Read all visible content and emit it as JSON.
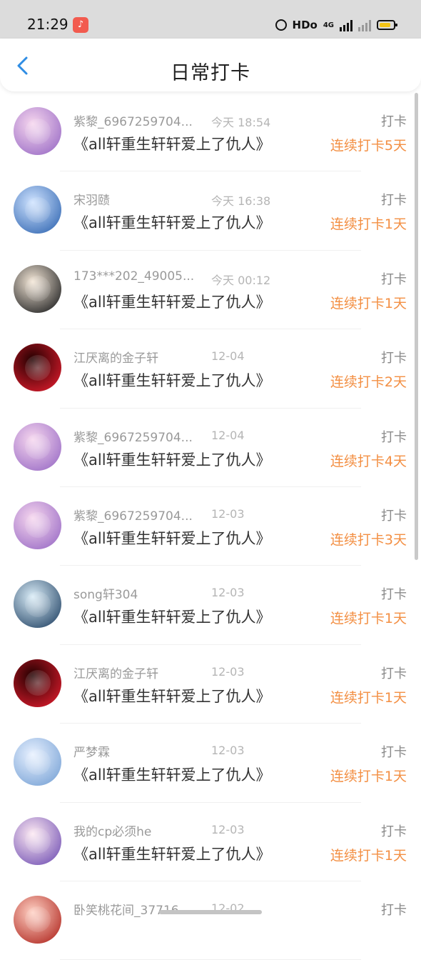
{
  "status_bar": {
    "time": "21:29",
    "app_icon": "music-app-icon",
    "hd": "HDo",
    "network": "4G"
  },
  "header": {
    "title": "日常打卡",
    "back_icon": "chevron-left-icon"
  },
  "entries": [
    {
      "name": "紫黎_6967259704...",
      "time": "今天 18:54",
      "book": "《all轩重生轩轩爱上了仇人》",
      "action": "打卡",
      "streak": "连续打卡5天",
      "avatar_colors": [
        "#f6d6ee",
        "#9f72c8"
      ]
    },
    {
      "name": "宋羽赜",
      "time": "今天 16:38",
      "book": "《all轩重生轩轩爱上了仇人》",
      "action": "打卡",
      "streak": "连续打卡1天",
      "avatar_colors": [
        "#cfe3ff",
        "#3c6fb7"
      ]
    },
    {
      "name": "173***202_49005...",
      "time": "今天 00:12",
      "book": "《all轩重生轩轩爱上了仇人》",
      "action": "打卡",
      "streak": "连续打卡1天",
      "avatar_colors": [
        "#f3e6d6",
        "#2a2a2a"
      ]
    },
    {
      "name": "江厌离的金子轩",
      "time": "12-04",
      "book": "《all轩重生轩轩爱上了仇人》",
      "action": "打卡",
      "streak": "连续打卡2天",
      "avatar_colors": [
        "#220000",
        "#d11a2a"
      ]
    },
    {
      "name": "紫黎_6967259704...",
      "time": "12-04",
      "book": "《all轩重生轩轩爱上了仇人》",
      "action": "打卡",
      "streak": "连续打卡4天",
      "avatar_colors": [
        "#f6d6ee",
        "#9f72c8"
      ]
    },
    {
      "name": "紫黎_6967259704...",
      "time": "12-03",
      "book": "《all轩重生轩轩爱上了仇人》",
      "action": "打卡",
      "streak": "连续打卡3天",
      "avatar_colors": [
        "#f6d6ee",
        "#9f72c8"
      ]
    },
    {
      "name": "song轩304",
      "time": "12-03",
      "book": "《all轩重生轩轩爱上了仇人》",
      "action": "打卡",
      "streak": "连续打卡1天",
      "avatar_colors": [
        "#d9ecf7",
        "#2f4f6f"
      ]
    },
    {
      "name": "江厌离的金子轩",
      "time": "12-03",
      "book": "《all轩重生轩轩爱上了仇人》",
      "action": "打卡",
      "streak": "连续打卡1天",
      "avatar_colors": [
        "#220000",
        "#d11a2a"
      ]
    },
    {
      "name": "严梦霖",
      "time": "12-03",
      "book": "《all轩重生轩轩爱上了仇人》",
      "action": "打卡",
      "streak": "连续打卡1天",
      "avatar_colors": [
        "#e8f1ff",
        "#7fa7d8"
      ]
    },
    {
      "name": "我的cp必须he",
      "time": "12-03",
      "book": "《all轩重生轩轩爱上了仇人》",
      "action": "打卡",
      "streak": "连续打卡1天",
      "avatar_colors": [
        "#fde9f2",
        "#7b5bb8"
      ]
    },
    {
      "name": "卧笑桃花间_37716...",
      "time": "12-02",
      "book": "",
      "action": "打卡",
      "streak": "",
      "avatar_colors": [
        "#ffd1c4",
        "#b5322a"
      ]
    }
  ]
}
